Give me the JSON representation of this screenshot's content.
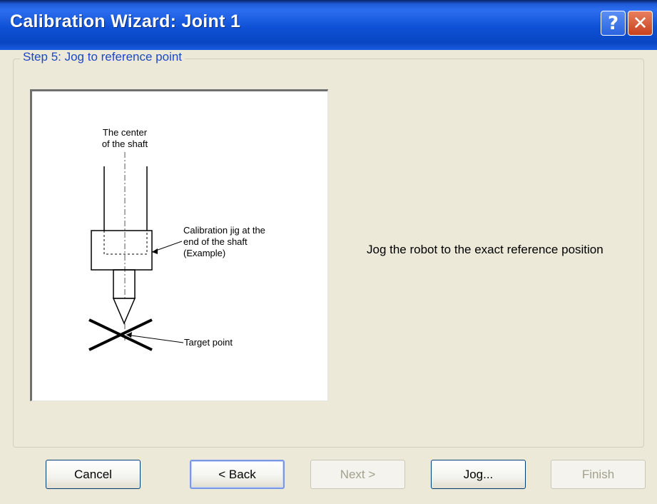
{
  "window": {
    "title": "Calibration Wizard: Joint 1",
    "help_glyph": "?",
    "close_glyph": "✕"
  },
  "step": {
    "label": "Step 5: Jog to reference point"
  },
  "illustration": {
    "center_label_line1": "The center",
    "center_label_line2": "of the shaft",
    "jig_label_line1": "Calibration jig at the",
    "jig_label_line2": "end of the shaft",
    "jig_label_line3": "(Example)",
    "target_label": "Target point"
  },
  "instruction": "Jog the robot to the exact reference position",
  "buttons": {
    "cancel": "Cancel",
    "back": "< Back",
    "next": "Next >",
    "jog": "Jog...",
    "finish": "Finish"
  },
  "colors": {
    "titlebar": "#0846c2",
    "group_label": "#1c48c8",
    "dialog_bg": "#ece9d8"
  }
}
